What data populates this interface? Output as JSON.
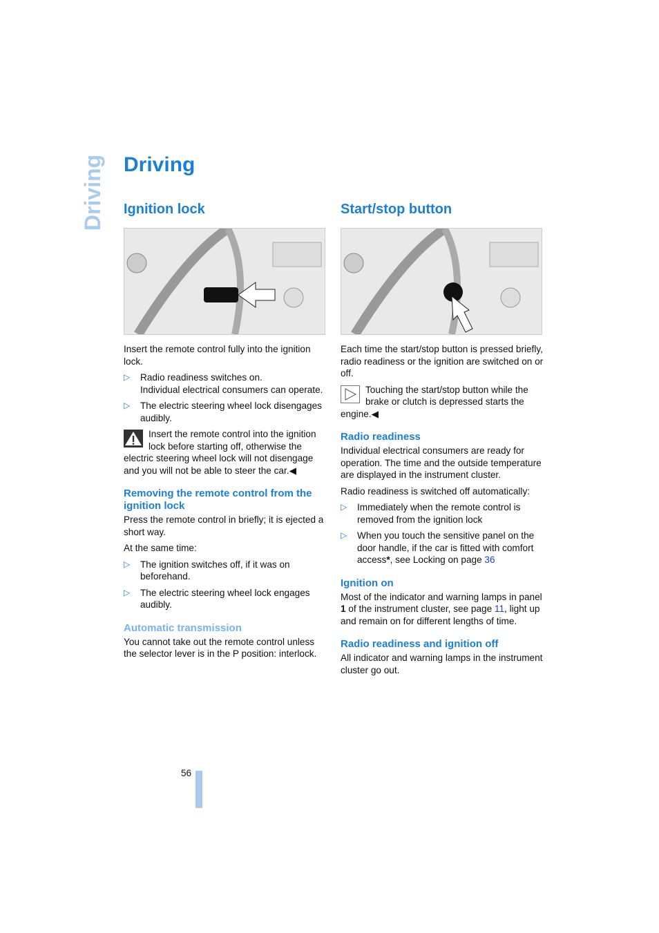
{
  "side_tab": "Driving",
  "title": "Driving",
  "left": {
    "heading": "Ignition lock",
    "intro": "Insert the remote control fully into the ignition lock.",
    "bullets": [
      {
        "line1": "Radio readiness switches on.",
        "line2": "Individual electrical consumers can operate."
      },
      {
        "line1": "The electric steering wheel lock disengages audibly."
      }
    ],
    "warning": "Insert the remote control into the ignition lock before starting off, otherwise the electric steering wheel lock will not disengage and you will not be able to steer the car.",
    "removing": {
      "heading": "Removing the remote control from the ignition lock",
      "text": "Press the remote control in briefly; it is ejected a short way.",
      "same_time": "At the same time:",
      "bullets": [
        "The ignition switches off, if it was on beforehand.",
        "The electric steering wheel lock engages audibly."
      ]
    },
    "auto": {
      "heading": "Automatic transmission",
      "text": "You cannot take out the remote control unless the selector lever is in the P position: interlock."
    }
  },
  "right": {
    "heading": "Start/stop button",
    "intro": "Each time the start/stop button is pressed briefly, radio readiness or the ignition are switched on or off.",
    "note": "Touching the start/stop button while the brake or clutch is depressed starts the engine.",
    "radio": {
      "heading": "Radio readiness",
      "text": "Individual electrical consumers are ready for operation. The time and the outside temperature are displayed in the instrument cluster.",
      "auto_off": "Radio readiness is switched off automatically:",
      "bullet1": "Immediately when the remote control is removed from the ignition lock",
      "bullet2_pre": "When you touch the sensitive panel on the door handle, if the car is fitted with comfort access",
      "bullet2_star": "*",
      "bullet2_mid": ", see Locking on page ",
      "bullet2_page": "36"
    },
    "ign": {
      "heading": "Ignition on",
      "pre": "Most of the indicator and warning lamps in panel ",
      "bold": "1",
      "mid": " of the instrument cluster, see page ",
      "page": "11",
      "post": ", light up and remain on for different lengths of time."
    },
    "off": {
      "heading": "Radio readiness and ignition off",
      "text": "All indicator and warning lamps in the instrument cluster go out."
    }
  },
  "page_number": "56",
  "colors": {
    "heading": "#1b7fd6",
    "subheading_light": "#76b3ee",
    "tab": "#a8cbee",
    "link": "#1b3fd6"
  }
}
